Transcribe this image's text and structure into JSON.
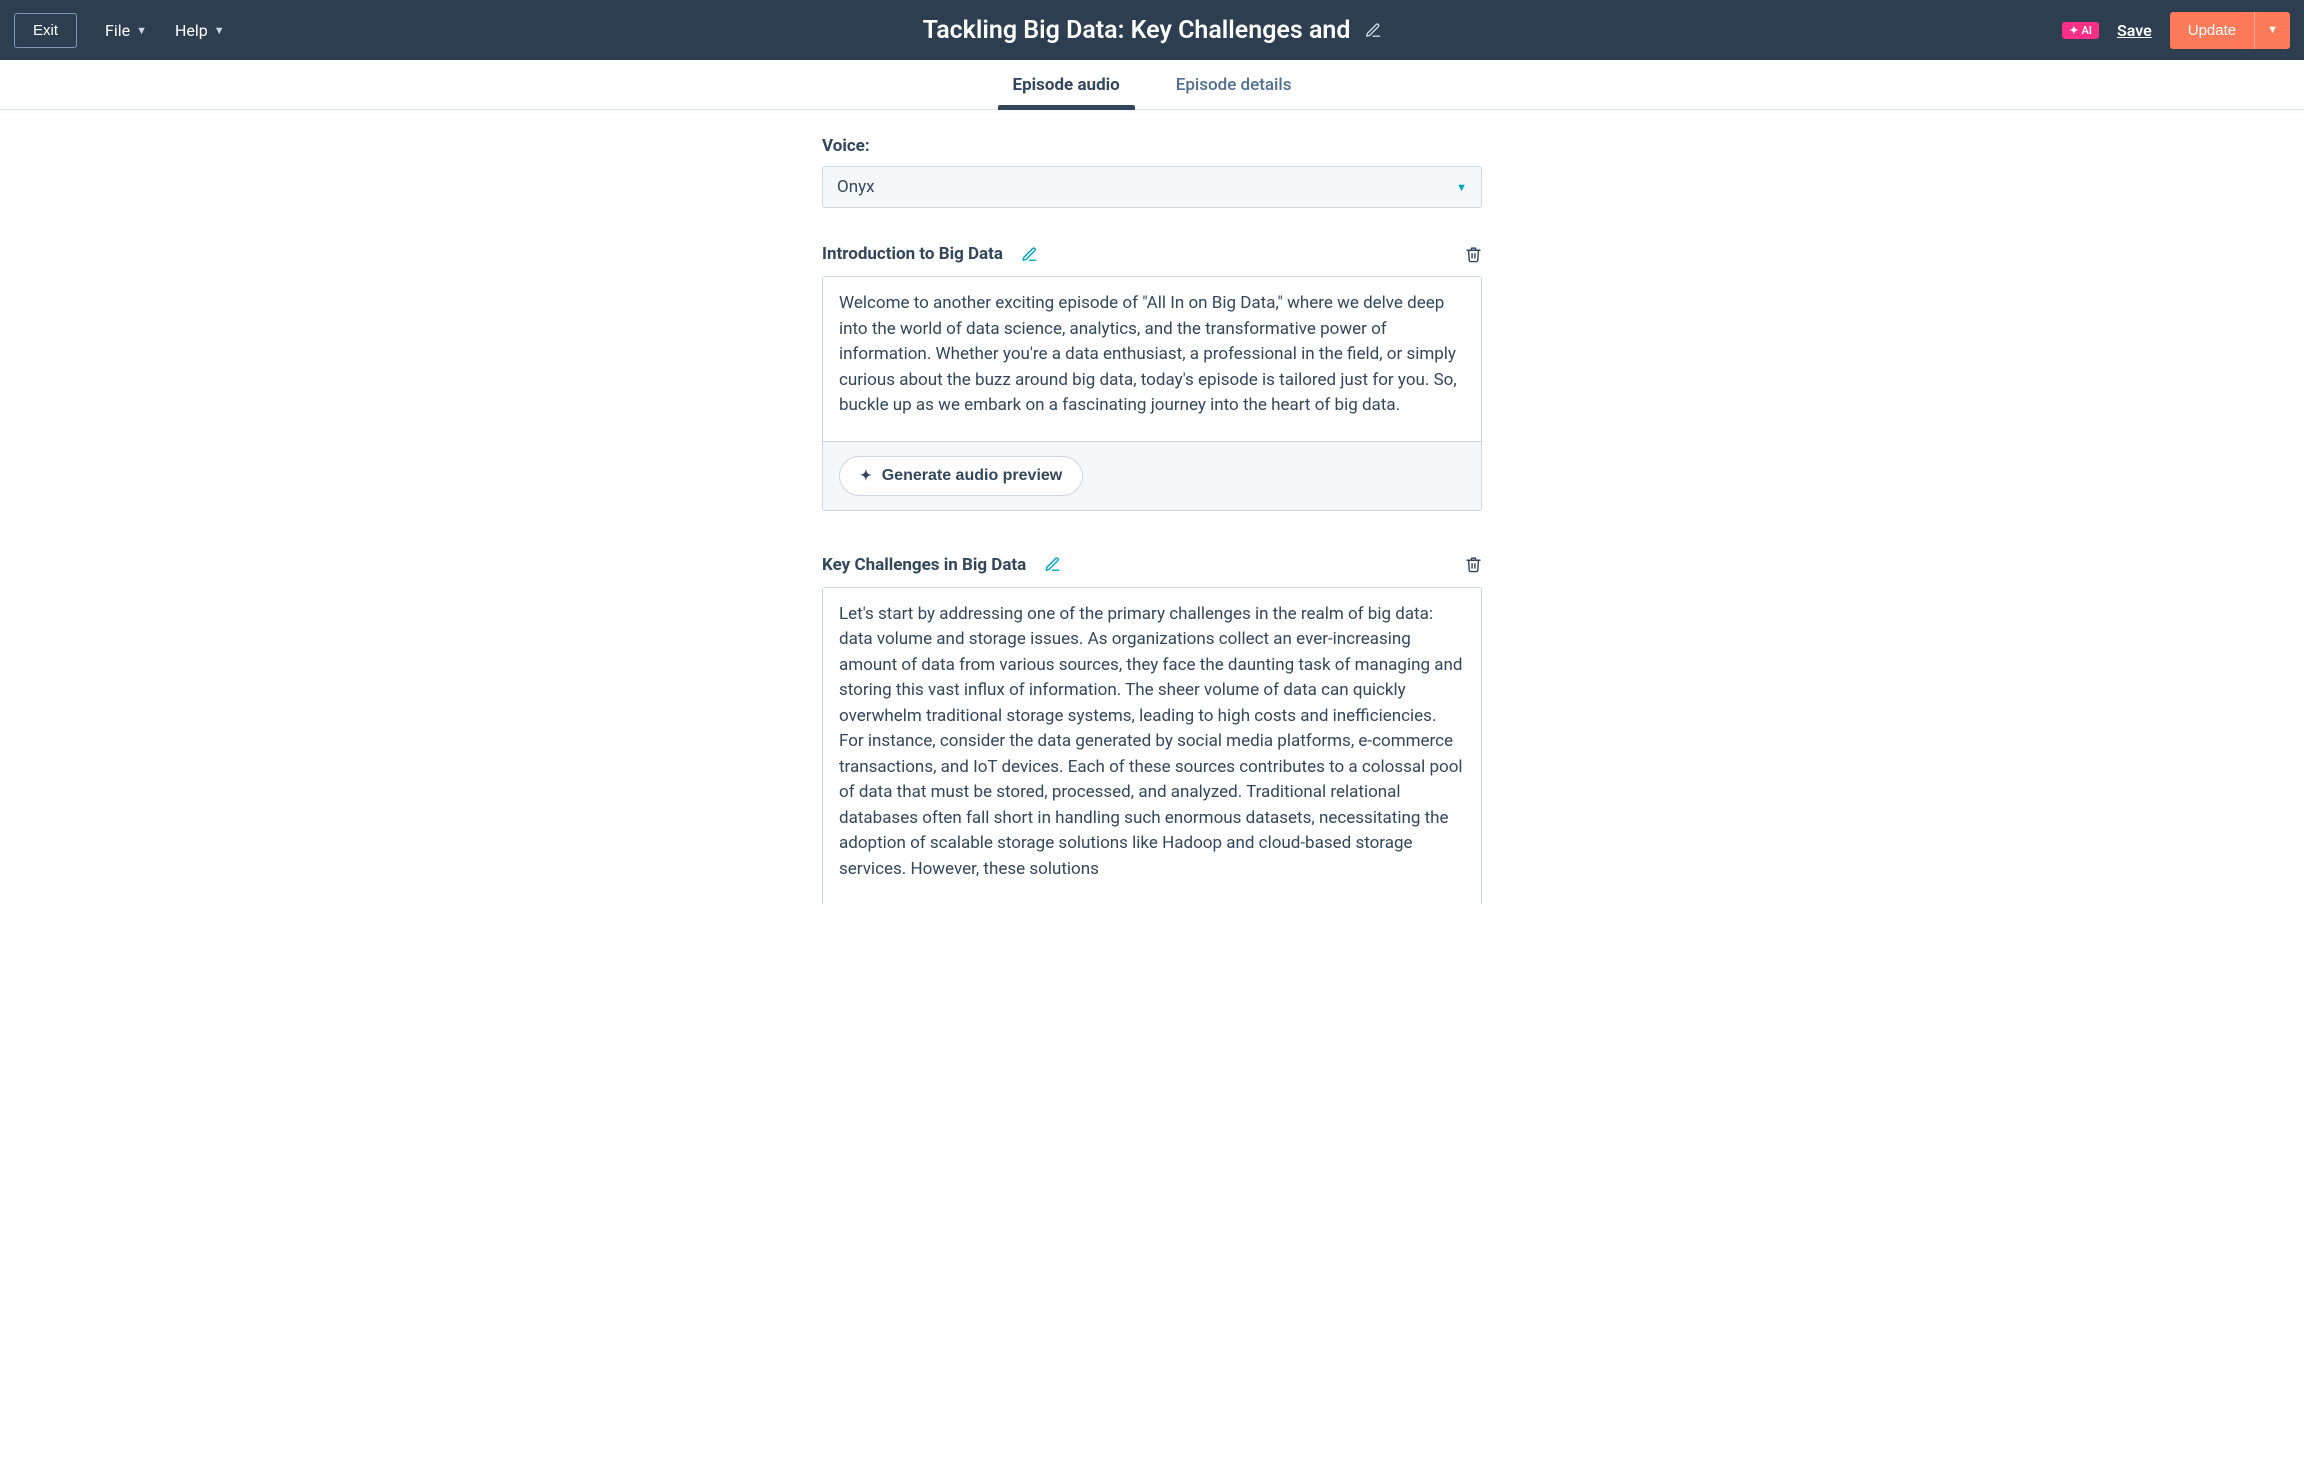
{
  "topbar": {
    "exit": "Exit",
    "menus": {
      "file": "File",
      "help": "Help"
    },
    "title": "Tackling Big Data: Key Challenges and",
    "ai_badge": "AI",
    "save": "Save",
    "update": "Update"
  },
  "tabs": {
    "audio": "Episode audio",
    "details": "Episode details"
  },
  "voice": {
    "label": "Voice:",
    "value": "Onyx"
  },
  "sections": [
    {
      "title": "Introduction to Big Data",
      "body": "Welcome to another exciting episode of \"All In on Big Data,\" where we delve deep into the world of data science, analytics, and the transformative power of information. Whether you're a data enthusiast, a professional in the field, or simply curious about the buzz around big data, today's episode is tailored just for you. So, buckle up as we embark on a fascinating journey into the heart of big data.",
      "generate_label": "Generate audio preview"
    },
    {
      "title": "Key Challenges in Big Data",
      "body": "Let's start by addressing one of the primary challenges in the realm of big data: data volume and storage issues. As organizations collect an ever-increasing amount of data from various sources, they face the daunting task of managing and storing this vast influx of information. The sheer volume of data can quickly overwhelm traditional storage systems, leading to high costs and inefficiencies. For instance, consider the data generated by social media platforms, e-commerce transactions, and IoT devices. Each of these sources contributes to a colossal pool of data that must be stored, processed, and analyzed. Traditional relational databases often fall short in handling such enormous datasets, necessitating the adoption of scalable storage solutions like Hadoop and cloud-based storage services. However, these solutions"
    }
  ]
}
